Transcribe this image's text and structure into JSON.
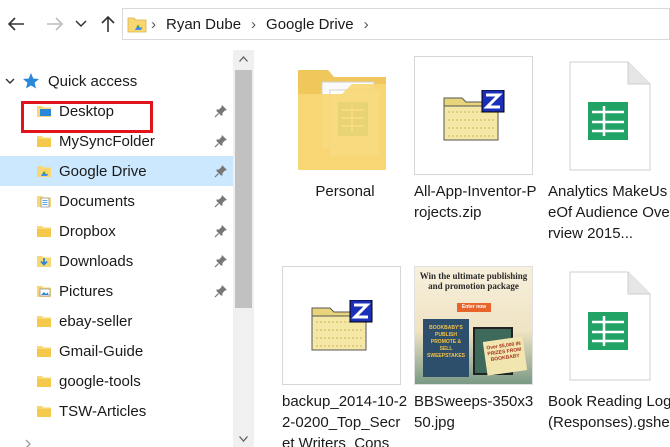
{
  "breadcrumb": {
    "items": [
      "Ryan Dube",
      "Google Drive"
    ]
  },
  "sidebar": {
    "quick_access_label": "Quick access",
    "items": [
      {
        "label": "Desktop",
        "pinned": true,
        "icon": "desktop-folder-icon"
      },
      {
        "label": "MySyncFolder",
        "pinned": true,
        "icon": "folder-icon"
      },
      {
        "label": "Google Drive",
        "pinned": true,
        "icon": "google-drive-folder-icon",
        "selected": true
      },
      {
        "label": "Documents",
        "pinned": true,
        "icon": "documents-folder-icon"
      },
      {
        "label": "Dropbox",
        "pinned": true,
        "icon": "folder-icon"
      },
      {
        "label": "Downloads",
        "pinned": true,
        "icon": "downloads-folder-icon"
      },
      {
        "label": "Pictures",
        "pinned": true,
        "icon": "pictures-folder-icon"
      },
      {
        "label": "ebay-seller",
        "pinned": false,
        "icon": "folder-icon"
      },
      {
        "label": "Gmail-Guide",
        "pinned": false,
        "icon": "folder-icon"
      },
      {
        "label": "google-tools",
        "pinned": false,
        "icon": "folder-icon"
      },
      {
        "label": "TSW-Articles",
        "pinned": false,
        "icon": "folder-icon"
      }
    ]
  },
  "files": [
    {
      "name": "Personal",
      "type": "folder"
    },
    {
      "name": "All-App-Inventor-Projects.zip",
      "type": "zip"
    },
    {
      "name": "Analytics MakeUseOf Audience Overview 2015...",
      "type": "sheet"
    },
    {
      "name": "backup_2014-10-22-0200_Top_Secret Writers_Cons",
      "type": "zip"
    },
    {
      "name": "BBSweeps-350x350.jpg",
      "type": "image"
    },
    {
      "name": "Book Reading Log (Responses).gshe",
      "type": "sheet"
    }
  ],
  "bbsweeps": {
    "headline": "Win the ultimate publishing and promotion package",
    "button": "Enter now",
    "book1": "BOOKBABY'S PUBLISH PROMOTE & SELL SWEEPSTAKES",
    "book2": "Over $5,000 IN PRIZES FROM BOOKBABY"
  },
  "colors": {
    "selection": "#cce8ff",
    "highlight_border": "#e0141b",
    "folder": "#f8d775",
    "sheets_green": "#21a366"
  }
}
